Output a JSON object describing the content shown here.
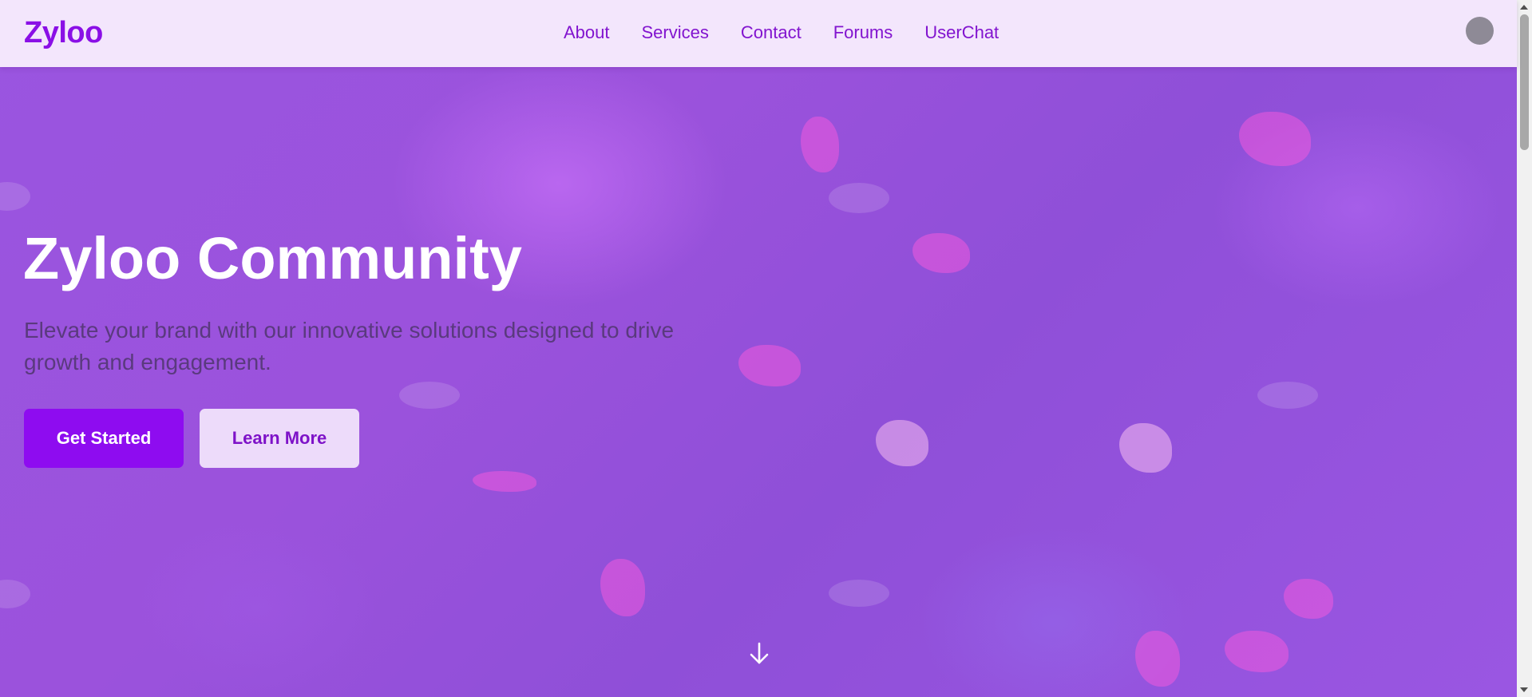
{
  "brand": {
    "name": "Zyloo"
  },
  "nav": {
    "items": [
      {
        "label": "About"
      },
      {
        "label": "Services"
      },
      {
        "label": "Contact"
      },
      {
        "label": "Forums"
      },
      {
        "label": "UserChat"
      }
    ]
  },
  "user": {
    "avatar_icon": "user-avatar"
  },
  "hero": {
    "title": "Zyloo Community",
    "subtitle": "Elevate your brand with our innovative solutions designed to drive growth and engagement.",
    "primary_button": "Get Started",
    "secondary_button": "Learn More",
    "scroll_icon": "arrow-down-icon"
  },
  "colors": {
    "brand": "#8a0fe6",
    "primary_button": "#8e0cf0",
    "secondary_button": "#eddbfa",
    "header_bg": "#f3e6fc",
    "hero_overlay": "#9a55e0"
  }
}
